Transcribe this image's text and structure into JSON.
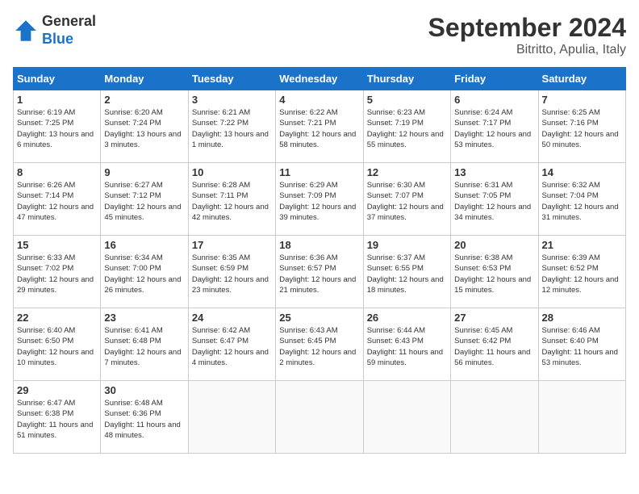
{
  "header": {
    "logo_line1": "General",
    "logo_line2": "Blue",
    "month": "September 2024",
    "location": "Bitritto, Apulia, Italy"
  },
  "weekdays": [
    "Sunday",
    "Monday",
    "Tuesday",
    "Wednesday",
    "Thursday",
    "Friday",
    "Saturday"
  ],
  "weeks": [
    [
      {
        "day": "1",
        "sunrise": "6:19 AM",
        "sunset": "7:25 PM",
        "daylight": "13 hours and 6 minutes."
      },
      {
        "day": "2",
        "sunrise": "6:20 AM",
        "sunset": "7:24 PM",
        "daylight": "13 hours and 3 minutes."
      },
      {
        "day": "3",
        "sunrise": "6:21 AM",
        "sunset": "7:22 PM",
        "daylight": "13 hours and 1 minute."
      },
      {
        "day": "4",
        "sunrise": "6:22 AM",
        "sunset": "7:21 PM",
        "daylight": "12 hours and 58 minutes."
      },
      {
        "day": "5",
        "sunrise": "6:23 AM",
        "sunset": "7:19 PM",
        "daylight": "12 hours and 55 minutes."
      },
      {
        "day": "6",
        "sunrise": "6:24 AM",
        "sunset": "7:17 PM",
        "daylight": "12 hours and 53 minutes."
      },
      {
        "day": "7",
        "sunrise": "6:25 AM",
        "sunset": "7:16 PM",
        "daylight": "12 hours and 50 minutes."
      }
    ],
    [
      {
        "day": "8",
        "sunrise": "6:26 AM",
        "sunset": "7:14 PM",
        "daylight": "12 hours and 47 minutes."
      },
      {
        "day": "9",
        "sunrise": "6:27 AM",
        "sunset": "7:12 PM",
        "daylight": "12 hours and 45 minutes."
      },
      {
        "day": "10",
        "sunrise": "6:28 AM",
        "sunset": "7:11 PM",
        "daylight": "12 hours and 42 minutes."
      },
      {
        "day": "11",
        "sunrise": "6:29 AM",
        "sunset": "7:09 PM",
        "daylight": "12 hours and 39 minutes."
      },
      {
        "day": "12",
        "sunrise": "6:30 AM",
        "sunset": "7:07 PM",
        "daylight": "12 hours and 37 minutes."
      },
      {
        "day": "13",
        "sunrise": "6:31 AM",
        "sunset": "7:05 PM",
        "daylight": "12 hours and 34 minutes."
      },
      {
        "day": "14",
        "sunrise": "6:32 AM",
        "sunset": "7:04 PM",
        "daylight": "12 hours and 31 minutes."
      }
    ],
    [
      {
        "day": "15",
        "sunrise": "6:33 AM",
        "sunset": "7:02 PM",
        "daylight": "12 hours and 29 minutes."
      },
      {
        "day": "16",
        "sunrise": "6:34 AM",
        "sunset": "7:00 PM",
        "daylight": "12 hours and 26 minutes."
      },
      {
        "day": "17",
        "sunrise": "6:35 AM",
        "sunset": "6:59 PM",
        "daylight": "12 hours and 23 minutes."
      },
      {
        "day": "18",
        "sunrise": "6:36 AM",
        "sunset": "6:57 PM",
        "daylight": "12 hours and 21 minutes."
      },
      {
        "day": "19",
        "sunrise": "6:37 AM",
        "sunset": "6:55 PM",
        "daylight": "12 hours and 18 minutes."
      },
      {
        "day": "20",
        "sunrise": "6:38 AM",
        "sunset": "6:53 PM",
        "daylight": "12 hours and 15 minutes."
      },
      {
        "day": "21",
        "sunrise": "6:39 AM",
        "sunset": "6:52 PM",
        "daylight": "12 hours and 12 minutes."
      }
    ],
    [
      {
        "day": "22",
        "sunrise": "6:40 AM",
        "sunset": "6:50 PM",
        "daylight": "12 hours and 10 minutes."
      },
      {
        "day": "23",
        "sunrise": "6:41 AM",
        "sunset": "6:48 PM",
        "daylight": "12 hours and 7 minutes."
      },
      {
        "day": "24",
        "sunrise": "6:42 AM",
        "sunset": "6:47 PM",
        "daylight": "12 hours and 4 minutes."
      },
      {
        "day": "25",
        "sunrise": "6:43 AM",
        "sunset": "6:45 PM",
        "daylight": "12 hours and 2 minutes."
      },
      {
        "day": "26",
        "sunrise": "6:44 AM",
        "sunset": "6:43 PM",
        "daylight": "11 hours and 59 minutes."
      },
      {
        "day": "27",
        "sunrise": "6:45 AM",
        "sunset": "6:42 PM",
        "daylight": "11 hours and 56 minutes."
      },
      {
        "day": "28",
        "sunrise": "6:46 AM",
        "sunset": "6:40 PM",
        "daylight": "11 hours and 53 minutes."
      }
    ],
    [
      {
        "day": "29",
        "sunrise": "6:47 AM",
        "sunset": "6:38 PM",
        "daylight": "11 hours and 51 minutes."
      },
      {
        "day": "30",
        "sunrise": "6:48 AM",
        "sunset": "6:36 PM",
        "daylight": "11 hours and 48 minutes."
      },
      null,
      null,
      null,
      null,
      null
    ]
  ]
}
